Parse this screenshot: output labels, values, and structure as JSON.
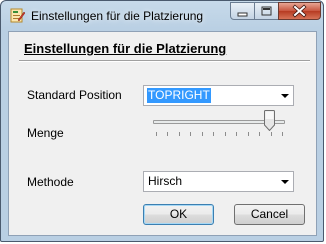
{
  "window": {
    "title": "Einstellungen für die Platzierung"
  },
  "dialog": {
    "heading": "Einstellungen für die Platzierung",
    "standard_position": {
      "label": "Standard Position",
      "value": "TOPRIGHT"
    },
    "menge": {
      "label": "Menge",
      "slider_level_fraction": 0.9,
      "tick_count": 12
    },
    "methode": {
      "label": "Methode",
      "value": "Hirsch"
    },
    "ok_label": "OK",
    "cancel_label": "Cancel"
  },
  "icons": {
    "app": "edit-document-icon",
    "minimize": "minimize-icon",
    "maximize": "maximize-icon",
    "close": "close-icon",
    "dropdown": "chevron-down-icon"
  },
  "colors": {
    "selection": "#3399ff",
    "close_button": "#c8553e",
    "frame": "#b9cfe3"
  }
}
